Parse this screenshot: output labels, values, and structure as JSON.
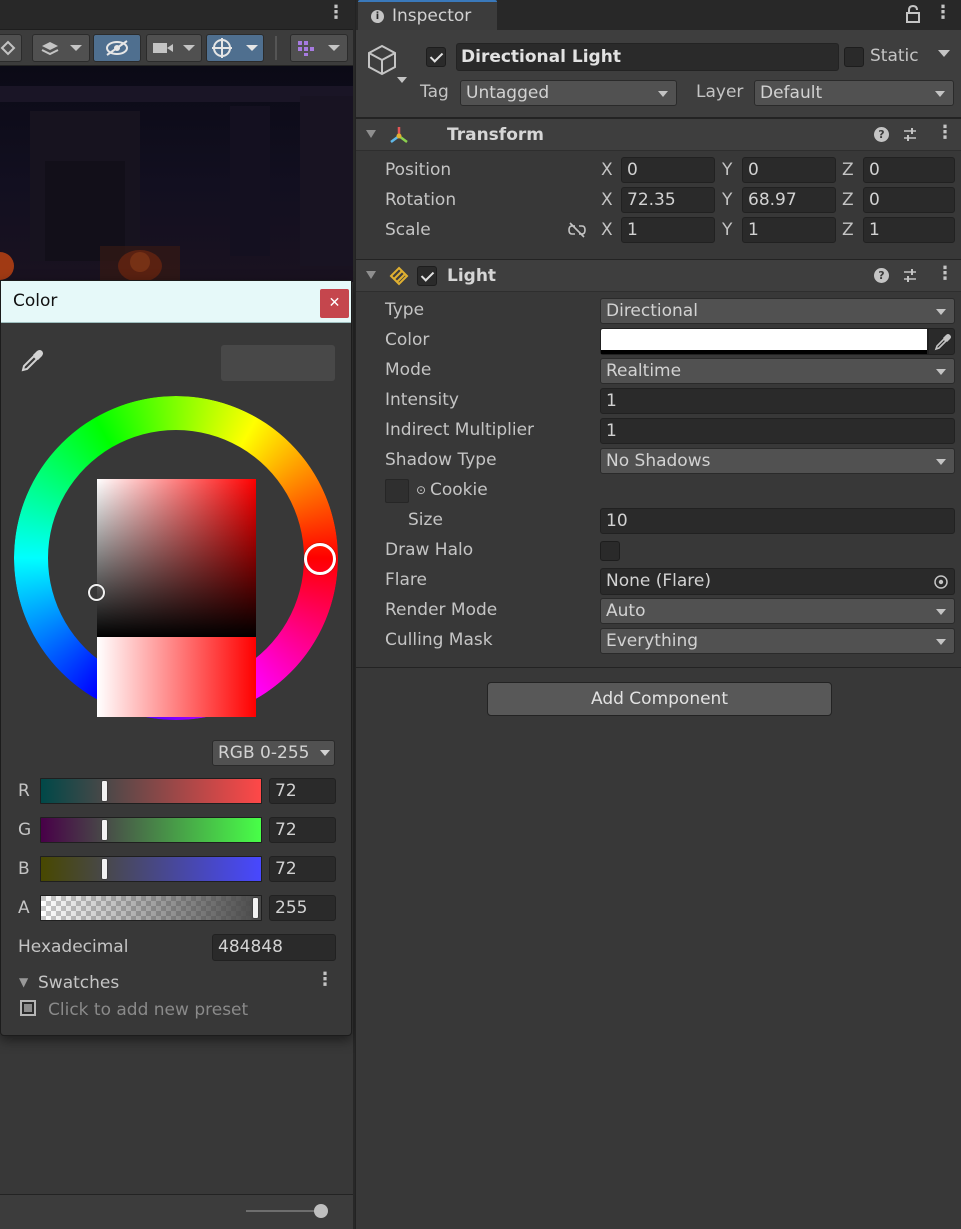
{
  "colors": {
    "accent": "#3a79bb",
    "panel_bg": "#383838",
    "header_bg": "#3e3e3e",
    "field_bg": "#2a2a2a",
    "picker_title_bg": "#e6f9f9",
    "close_red": "#c5464d"
  },
  "scene": {
    "toolbar_icons": [
      "tools-icon",
      "layers-icon",
      "visibility-icon",
      "camera-icon",
      "gizmo-icon",
      "grid-icon"
    ]
  },
  "color_picker": {
    "title": "Color",
    "mode": "RGB 0-255",
    "channels": [
      {
        "label": "R",
        "value": "72"
      },
      {
        "label": "G",
        "value": "72"
      },
      {
        "label": "B",
        "value": "72"
      },
      {
        "label": "A",
        "value": "255"
      }
    ],
    "hex_label": "Hexadecimal",
    "hex_value": "484848",
    "swatches_label": "Swatches",
    "preset_text": "Click to add new preset"
  },
  "inspector": {
    "tab_label": "Inspector",
    "object_name": "Directional Light",
    "static_label": "Static",
    "tag_label": "Tag",
    "tag_value": "Untagged",
    "layer_label": "Layer",
    "layer_value": "Default",
    "transform": {
      "title": "Transform",
      "rows": [
        {
          "label": "Position",
          "x": "0",
          "y": "0",
          "z": "0"
        },
        {
          "label": "Rotation",
          "x": "72.35",
          "y": "68.97",
          "z": "0"
        },
        {
          "label": "Scale",
          "x": "1",
          "y": "1",
          "z": "1"
        }
      ],
      "axes": [
        "X",
        "Y",
        "Z"
      ]
    },
    "light": {
      "title": "Light",
      "type_label": "Type",
      "type_value": "Directional",
      "color_label": "Color",
      "mode_label": "Mode",
      "mode_value": "Realtime",
      "intensity_label": "Intensity",
      "intensity_value": "1",
      "indirect_label": "Indirect Multiplier",
      "indirect_value": "1",
      "shadow_label": "Shadow Type",
      "shadow_value": "No Shadows",
      "cookie_label": "Cookie",
      "size_label": "Size",
      "size_value": "10",
      "halo_label": "Draw Halo",
      "flare_label": "Flare",
      "flare_value": "None (Flare)",
      "render_label": "Render Mode",
      "render_value": "Auto",
      "culling_label": "Culling Mask",
      "culling_value": "Everything"
    },
    "add_component": "Add Component"
  }
}
